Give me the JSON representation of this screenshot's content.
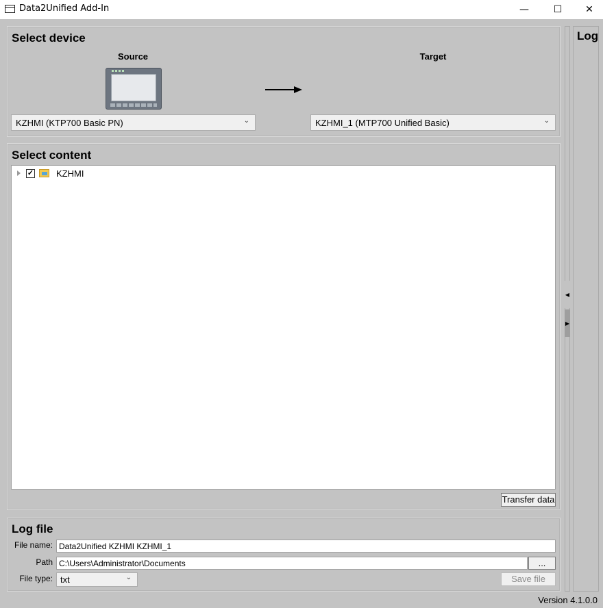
{
  "window": {
    "title": "Data2Unified Add-In",
    "minimize_icon": "minimize-icon",
    "maximize_icon": "maximize-icon",
    "close_icon": "close-icon"
  },
  "select_device": {
    "title": "Select device",
    "source_label": "Source",
    "target_label": "Target",
    "source_value": "KZHMI (KTP700 Basic PN)",
    "target_value": "KZHMI_1 (MTP700 Unified Basic)",
    "arrow_icon": "arrow-right-icon",
    "device_image": "hmi-panel-image"
  },
  "select_content": {
    "title": "Select content",
    "tree": [
      {
        "label": "KZHMI",
        "checked": true,
        "expanded": false
      }
    ],
    "transfer_button": "Transfer data"
  },
  "log_file": {
    "title": "Log file",
    "file_name_label": "File name:",
    "file_name_value": "Data2Unified KZHMI KZHMI_1",
    "path_label": "Path",
    "path_value": "C:\\Users\\Administrator\\Documents",
    "browse_button": "...",
    "file_type_label": "File type:",
    "file_type_value": "txt",
    "save_button": "Save file"
  },
  "log_panel": {
    "title": "Log"
  },
  "footer": {
    "version": "Version 4.1.0.0"
  }
}
